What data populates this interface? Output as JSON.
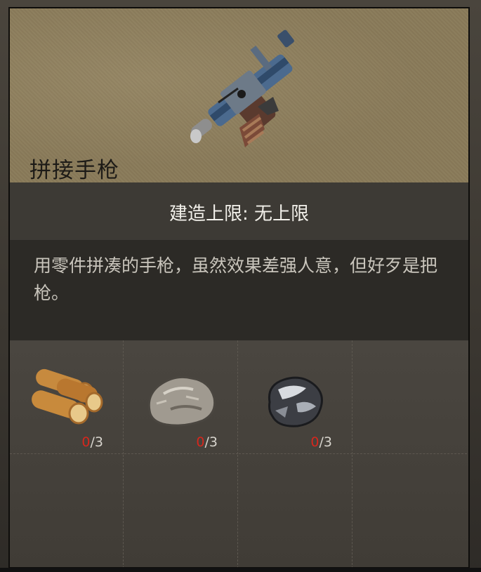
{
  "item": {
    "name": "拼接手枪",
    "icon": "pistol-icon",
    "build_limit": "建造上限: 无上限",
    "description": "用零件拼凑的手枪，虽然效果差强人意，但好歹是把枪。"
  },
  "materials": [
    {
      "icon": "wood-logs-icon",
      "have": "0",
      "need": "/3"
    },
    {
      "icon": "stone-icon",
      "have": "0",
      "need": "/3"
    },
    {
      "icon": "iron-ore-icon",
      "have": "0",
      "need": "/3"
    }
  ],
  "colors": {
    "header_bg": "#8a7b5a",
    "count_missing": "#d6271d",
    "text_light": "#f2f0ea"
  }
}
